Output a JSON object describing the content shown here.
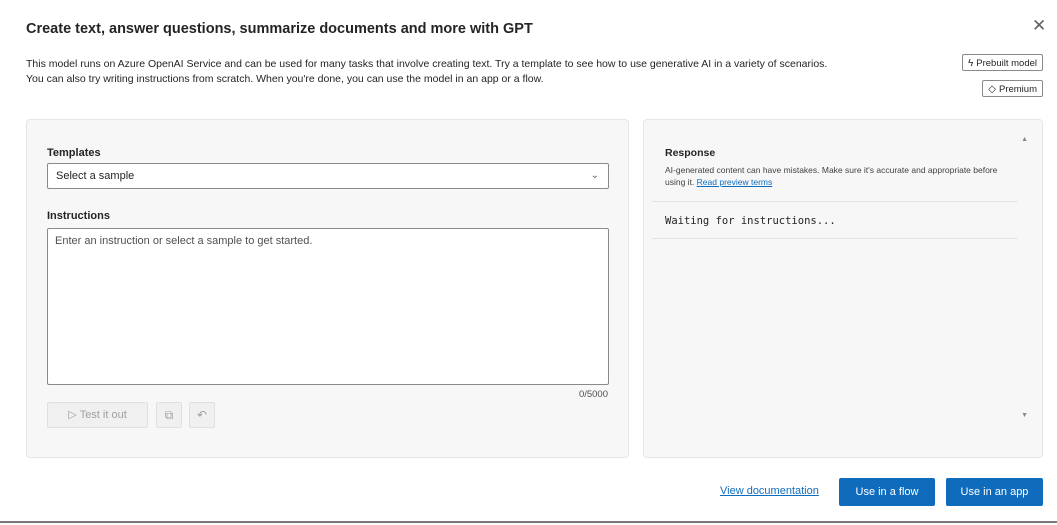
{
  "dialog": {
    "title": "Create text, answer questions, summarize documents and more with GPT",
    "close_icon": "✕",
    "description_line1": "This model runs on Azure OpenAI Service and can be used for many tasks that involve creating text. Try a template to see how to use generative AI in a variety of scenarios.",
    "description_line2": "You can also try writing instructions from scratch. When you're done, you can use the model in an app or a flow."
  },
  "tags": {
    "prebuilt_label": "Prebuilt model",
    "premium_label": "Premium"
  },
  "input": {
    "templates_label": "Templates",
    "templates_value": "Select a sample",
    "instructions_label": "Instructions",
    "instructions_placeholder": "Enter an instruction or select a sample to get started.",
    "counter": "0/5000",
    "test_button": "Test it out"
  },
  "response": {
    "title": "Response",
    "note": "AI-generated content can have mistakes. Make sure it's accurate and appropriate before using it.",
    "terms_link": "Read preview terms",
    "waiting": "Waiting for instructions..."
  },
  "footer": {
    "view_documentation": "View documentation",
    "use_in_flow": "Use in a flow",
    "use_in_app": "Use in an app"
  },
  "colors": {
    "accent": "#0f6cbd",
    "panel_bg": "#f7f7f7"
  },
  "icons": [
    "close-icon",
    "flash-icon",
    "diamond-icon",
    "chevron-down-icon",
    "send-icon",
    "copy-icon",
    "undo-icon",
    "scroll-up-icon",
    "scroll-down-icon"
  ]
}
